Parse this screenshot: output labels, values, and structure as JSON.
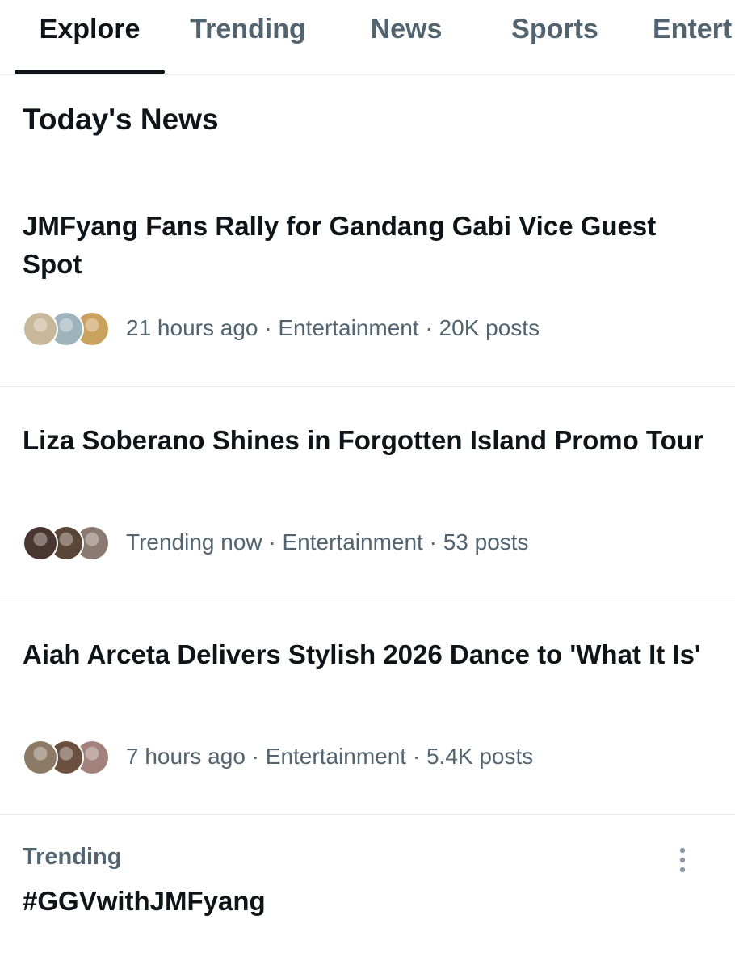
{
  "tabs": [
    {
      "label": "Explore",
      "active": true
    },
    {
      "label": "Trending",
      "active": false
    },
    {
      "label": "News",
      "active": false
    },
    {
      "label": "Sports",
      "active": false
    },
    {
      "label": "Entert",
      "active": false
    }
  ],
  "section": {
    "title": "Today's News"
  },
  "news": [
    {
      "headline": "JMFyang Fans Rally for Gandang Gabi Vice Guest Spot",
      "meta": "21 hours ago · Entertainment · 20K posts",
      "avatar_colors": [
        "#c9b79a",
        "#9fb3bd",
        "#c9a25e"
      ]
    },
    {
      "headline": "Liza Soberano Shines in Forgotten Island Promo Tour",
      "meta": "Trending now · Entertainment · 53 posts",
      "avatar_colors": [
        "#4a3630",
        "#5a4636",
        "#8a7a70"
      ]
    },
    {
      "headline": "Aiah Arceta Delivers Stylish 2026 Dance to 'What It Is'",
      "meta": "7 hours ago · Entertainment · 5.4K posts",
      "avatar_colors": [
        "#8c7a66",
        "#6b5040",
        "#a2827a"
      ]
    }
  ],
  "trending": {
    "label": "Trending",
    "title": "#GGVwithJMFyang"
  },
  "colors": {
    "primary_text": "#0f1419",
    "secondary_text": "#536471",
    "divider": "#e7eaec"
  }
}
